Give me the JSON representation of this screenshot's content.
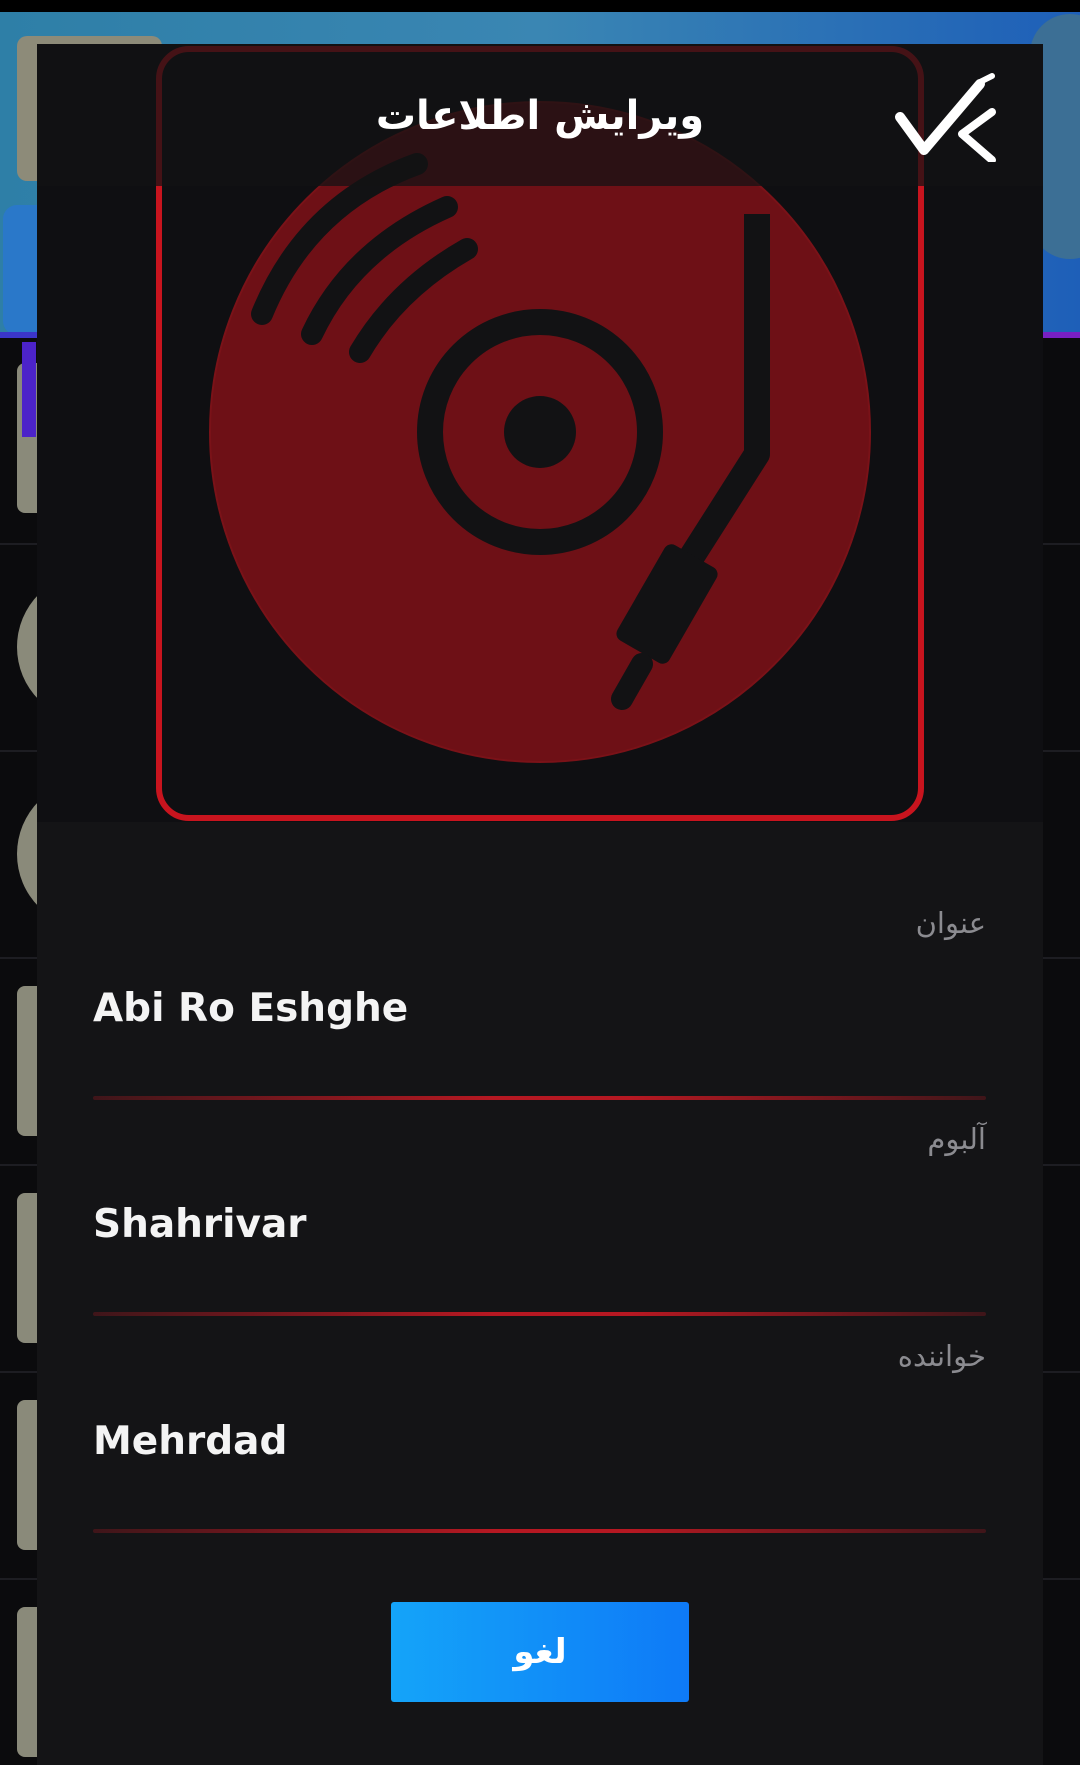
{
  "dialog": {
    "title": "ویرایش اطلاعات",
    "confirm_icon": "check-icon",
    "cover_icon": "vinyl-turntable-icon",
    "accent_color": "#c8141e",
    "fields": [
      {
        "label": "عنوان",
        "value": "Abi Ro Eshghe"
      },
      {
        "label": "آلبوم",
        "value": "Shahrivar"
      },
      {
        "label": "خواننده",
        "value": "Mehrdad"
      }
    ],
    "cancel_label": "لغو",
    "cancel_color": "#0e8af8"
  }
}
